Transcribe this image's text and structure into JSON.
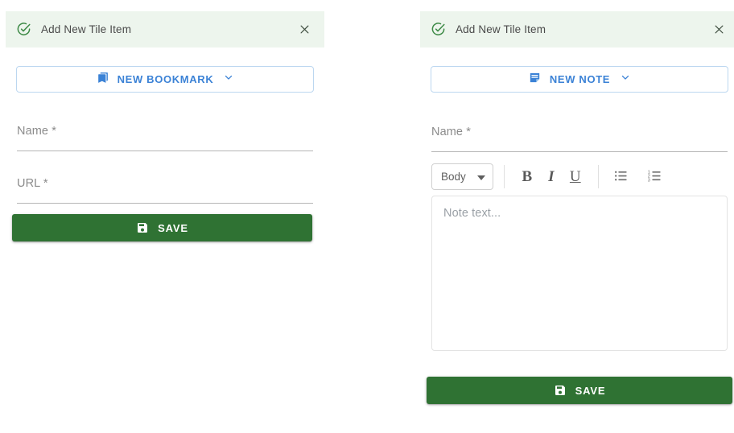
{
  "colors": {
    "header_bg": "#edf5ed",
    "header_icon": "#3d8a46",
    "accent_blue": "#3b82d6",
    "save_green": "#2f7233",
    "label_grey": "#8b8b8b"
  },
  "bookmark_panel": {
    "header": {
      "status_icon": "check-circle-icon",
      "title": "Add New Tile Item",
      "close_icon": "close-icon"
    },
    "type_selector": {
      "icon": "bookmark-collection-icon",
      "label": "NEW BOOKMARK",
      "caret_icon": "chevron-down-icon"
    },
    "fields": [
      {
        "label": "Name *",
        "value": "",
        "placeholder": "Name *"
      },
      {
        "label": "URL *",
        "value": "",
        "placeholder": "URL *"
      }
    ],
    "save": {
      "icon": "save-floppy-icon",
      "label": "SAVE"
    }
  },
  "note_panel": {
    "header": {
      "status_icon": "check-circle-icon",
      "title": "Add New Tile Item",
      "close_icon": "close-icon"
    },
    "type_selector": {
      "icon": "note-icon",
      "label": "NEW NOTE",
      "caret_icon": "chevron-down-icon"
    },
    "fields": [
      {
        "label": "Name *",
        "value": "",
        "placeholder": "Name *"
      }
    ],
    "toolbar": {
      "style_select": {
        "value": "Body",
        "caret_icon": "caret-down-icon"
      },
      "bold": "B",
      "italic": "I",
      "underline": "U",
      "bullet_list_icon": "bulleted-list-icon",
      "numbered_list_icon": "numbered-list-icon"
    },
    "note_editor": {
      "placeholder": "Note text...",
      "value": ""
    },
    "save": {
      "icon": "save-floppy-icon",
      "label": "SAVE"
    }
  }
}
